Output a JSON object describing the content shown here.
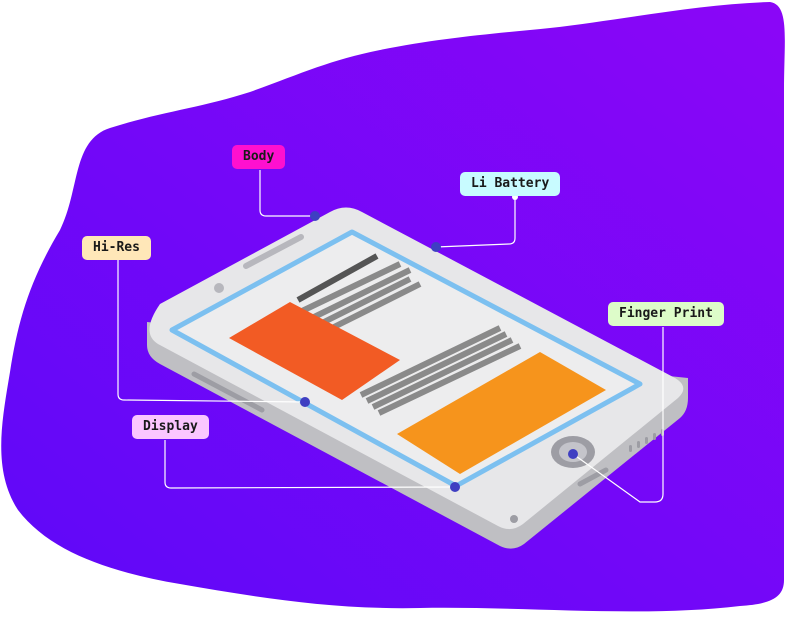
{
  "colors": {
    "background_gradient": [
      "#5e08f8",
      "#8b06f7"
    ],
    "device_body": "#e7e7e9",
    "device_side": "#bfbfc3",
    "screen_border": "#7cc0f0",
    "screen_fill": "#ededee",
    "image_block_1": "#f25b24",
    "image_block_2": "#f6941c",
    "text_lines": "#8a8a8a",
    "heading_line": "#555555",
    "connector_dot": "#3f3fc2",
    "connector_line": "#ffffff"
  },
  "labels": {
    "body": {
      "text": "Body",
      "color": "#ff10cf"
    },
    "li_battery": {
      "text": "Li Battery",
      "color": "#c8fbff"
    },
    "hi_res": {
      "text": "Hi-Res",
      "color": "#ffe7b8"
    },
    "finger_print": {
      "text": "Finger Print",
      "color": "#ddfcc9"
    },
    "display": {
      "text": "Display",
      "color": "#fbc6ff"
    }
  }
}
